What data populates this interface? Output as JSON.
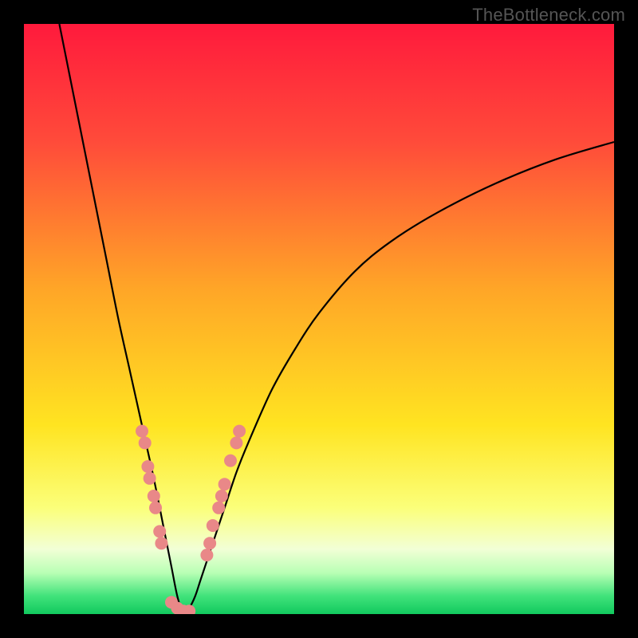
{
  "watermark": "TheBottleneck.com",
  "chart_data": {
    "type": "line",
    "title": "",
    "xlabel": "",
    "ylabel": "",
    "xlim": [
      0,
      100
    ],
    "ylim": [
      0,
      100
    ],
    "gradient_stops": [
      {
        "offset": 0,
        "color": "#ff1a3c"
      },
      {
        "offset": 20,
        "color": "#ff4b3a"
      },
      {
        "offset": 45,
        "color": "#ffa627"
      },
      {
        "offset": 68,
        "color": "#ffe421"
      },
      {
        "offset": 82,
        "color": "#fbff7a"
      },
      {
        "offset": 89,
        "color": "#f2ffd6"
      },
      {
        "offset": 93,
        "color": "#b9ffb5"
      },
      {
        "offset": 97,
        "color": "#3fe27a"
      },
      {
        "offset": 100,
        "color": "#12c95e"
      }
    ],
    "curve": {
      "description": "V-shaped bottleneck curve; y is mismatch percentage (higher = worse), reaching 0 at optimum x≈27",
      "x": [
        6,
        8,
        10,
        12,
        14,
        16,
        18,
        20,
        22,
        24,
        25,
        26,
        27,
        28,
        29,
        30,
        32,
        34,
        36,
        38,
        42,
        46,
        50,
        56,
        62,
        70,
        80,
        90,
        100
      ],
      "y": [
        100,
        90,
        80,
        70,
        60,
        50,
        41,
        32,
        23,
        13,
        8,
        3,
        0,
        1,
        3,
        6,
        12,
        18,
        24,
        29,
        38,
        45,
        51,
        58,
        63,
        68,
        73,
        77,
        80
      ]
    },
    "markers": {
      "color": "#e98888",
      "radius_px": 8,
      "points": [
        {
          "x": 20.0,
          "y": 31
        },
        {
          "x": 20.5,
          "y": 29
        },
        {
          "x": 21.0,
          "y": 25
        },
        {
          "x": 21.3,
          "y": 23
        },
        {
          "x": 22.0,
          "y": 20
        },
        {
          "x": 22.3,
          "y": 18
        },
        {
          "x": 23.0,
          "y": 14
        },
        {
          "x": 23.3,
          "y": 12
        },
        {
          "x": 25.0,
          "y": 2
        },
        {
          "x": 26.0,
          "y": 1
        },
        {
          "x": 27.0,
          "y": 0.5
        },
        {
          "x": 28.0,
          "y": 0.5
        },
        {
          "x": 31.0,
          "y": 10
        },
        {
          "x": 31.5,
          "y": 12
        },
        {
          "x": 32.0,
          "y": 15
        },
        {
          "x": 33.0,
          "y": 18
        },
        {
          "x": 33.5,
          "y": 20
        },
        {
          "x": 34.0,
          "y": 22
        },
        {
          "x": 35.0,
          "y": 26
        },
        {
          "x": 36.0,
          "y": 29
        },
        {
          "x": 36.5,
          "y": 31
        }
      ]
    }
  }
}
